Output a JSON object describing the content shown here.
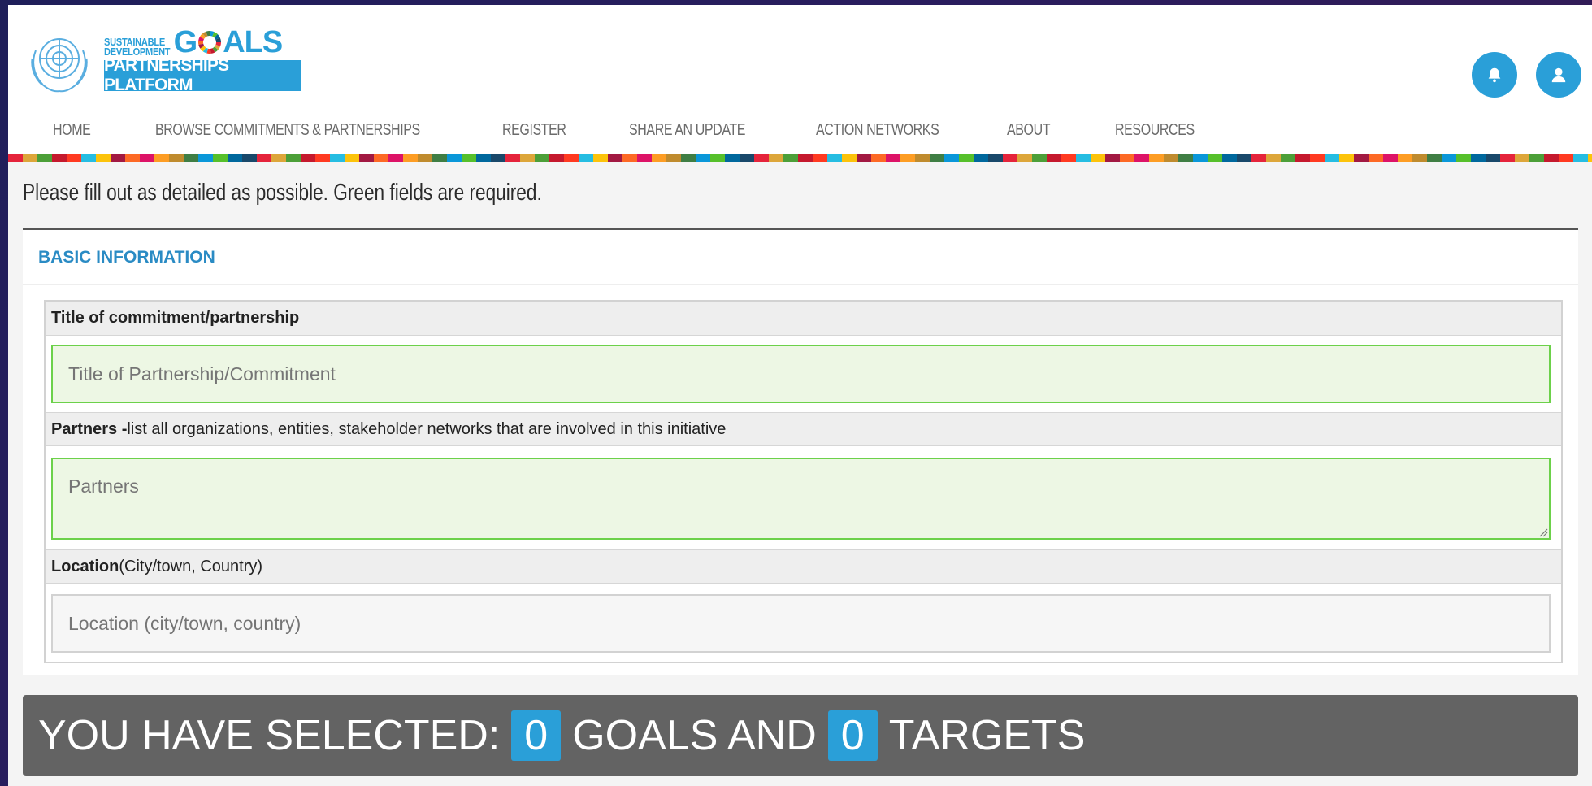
{
  "brand": {
    "line1": "SUSTAINABLE",
    "line2": "DEVELOPMENT",
    "goals_prefix": "G",
    "goals_suffix": "ALS",
    "platform": "PARTNERSHIPS PLATFORM"
  },
  "header": {
    "notification_icon": "bell-icon",
    "account_icon": "user-icon"
  },
  "nav": {
    "items": [
      "HOME",
      "BROWSE COMMITMENTS & PARTNERSHIPS",
      "REGISTER",
      "SHARE AN UPDATE",
      "ACTION NETWORKS",
      "ABOUT",
      "RESOURCES"
    ]
  },
  "form": {
    "intro": "Please fill out as detailed as possible. Green fields are required.",
    "section_title": "BASIC INFORMATION",
    "title_label": "Title of commitment/partnership",
    "title_placeholder": "Title of Partnership/Commitment",
    "partners_label_bold": "Partners -",
    "partners_label_rest": " list all organizations, entities, stakeholder networks that are involved in this initiative",
    "partners_placeholder": "Partners",
    "location_label_bold": "Location",
    "location_label_rest": " (City/town, Country)",
    "location_placeholder": "Location (city/town, country)"
  },
  "selection": {
    "prefix": "YOU HAVE SELECTED:",
    "goals_count": "0",
    "goals_label": "GOALS AND",
    "targets_count": "0",
    "targets_label": "TARGETS"
  },
  "colors": {
    "accent": "#2a9fd8",
    "required_border": "#6cd14a",
    "required_fill": "#edf7e4",
    "selection_bar": "#636363"
  }
}
